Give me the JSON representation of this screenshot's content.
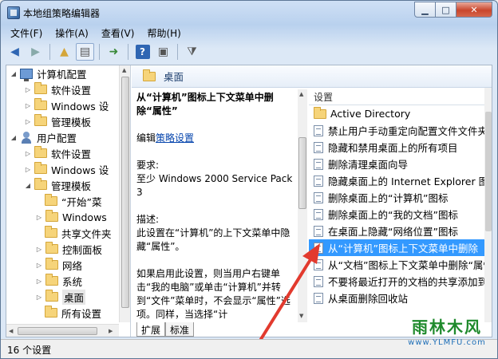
{
  "window": {
    "title": "本地组策略编辑器"
  },
  "menu": [
    "文件(F)",
    "操作(A)",
    "查看(V)",
    "帮助(H)"
  ],
  "tree": {
    "computer_config": "计算机配置",
    "software_settings_1": "软件设置",
    "windows_settings_1": "Windows 设",
    "admin_templates_1": "管理模板",
    "user_config": "用户配置",
    "software_settings_2": "软件设置",
    "windows_settings_2": "Windows 设",
    "admin_templates_2": "管理模板",
    "start_menu": "“开始”菜",
    "windows_components": "Windows",
    "shared_folders": "共享文件夹",
    "control_panel": "控制面板",
    "network": "网络",
    "system": "系统",
    "desktop": "桌面",
    "all_settings": "所有设置"
  },
  "rightpane": {
    "header": "桌面",
    "desc": {
      "title": "从“计算机”图标上下文菜单中删除“属性”",
      "edit_prefix": "编辑",
      "edit_link": "策略设置",
      "req_label": "要求:",
      "req_text": "至少 Windows 2000 Service Pack 3",
      "desc_label": "描述:",
      "desc_text": "此设置在“计算机”的上下文菜单中隐藏“属性”。",
      "desc_more": "如果启用此设置，则当用户右键单击“我的电脑”或单击“计算机”并转到“文件”菜单时，不会显示“属性”选项。同样，当选择“计"
    },
    "list_header": "设置",
    "items": [
      "Active Directory",
      "禁止用户手动重定向配置文件文件夹",
      "隐藏和禁用桌面上的所有项目",
      "删除清理桌面向导",
      "隐藏桌面上的 Internet Explorer 图标",
      "删除桌面上的“计算机”图标",
      "删除桌面上的“我的文档”图标",
      "在桌面上隐藏“网络位置”图标",
      "从“计算机”图标上下文菜单中删除",
      "从“文档”图标上下文菜单中删除“属性”",
      "不要将最近打开的文档的共享添加到",
      "从桌面删除回收站"
    ],
    "selected_index": 8,
    "tabs": [
      "扩展",
      "标准"
    ]
  },
  "status": {
    "text": "16 个设置"
  },
  "watermark": {
    "name": "雨林木风",
    "url": "www.YLMFU.com"
  },
  "colors": {
    "selection": "#3399ff",
    "arrow": "#e23a2e",
    "link": "#0645ad"
  }
}
